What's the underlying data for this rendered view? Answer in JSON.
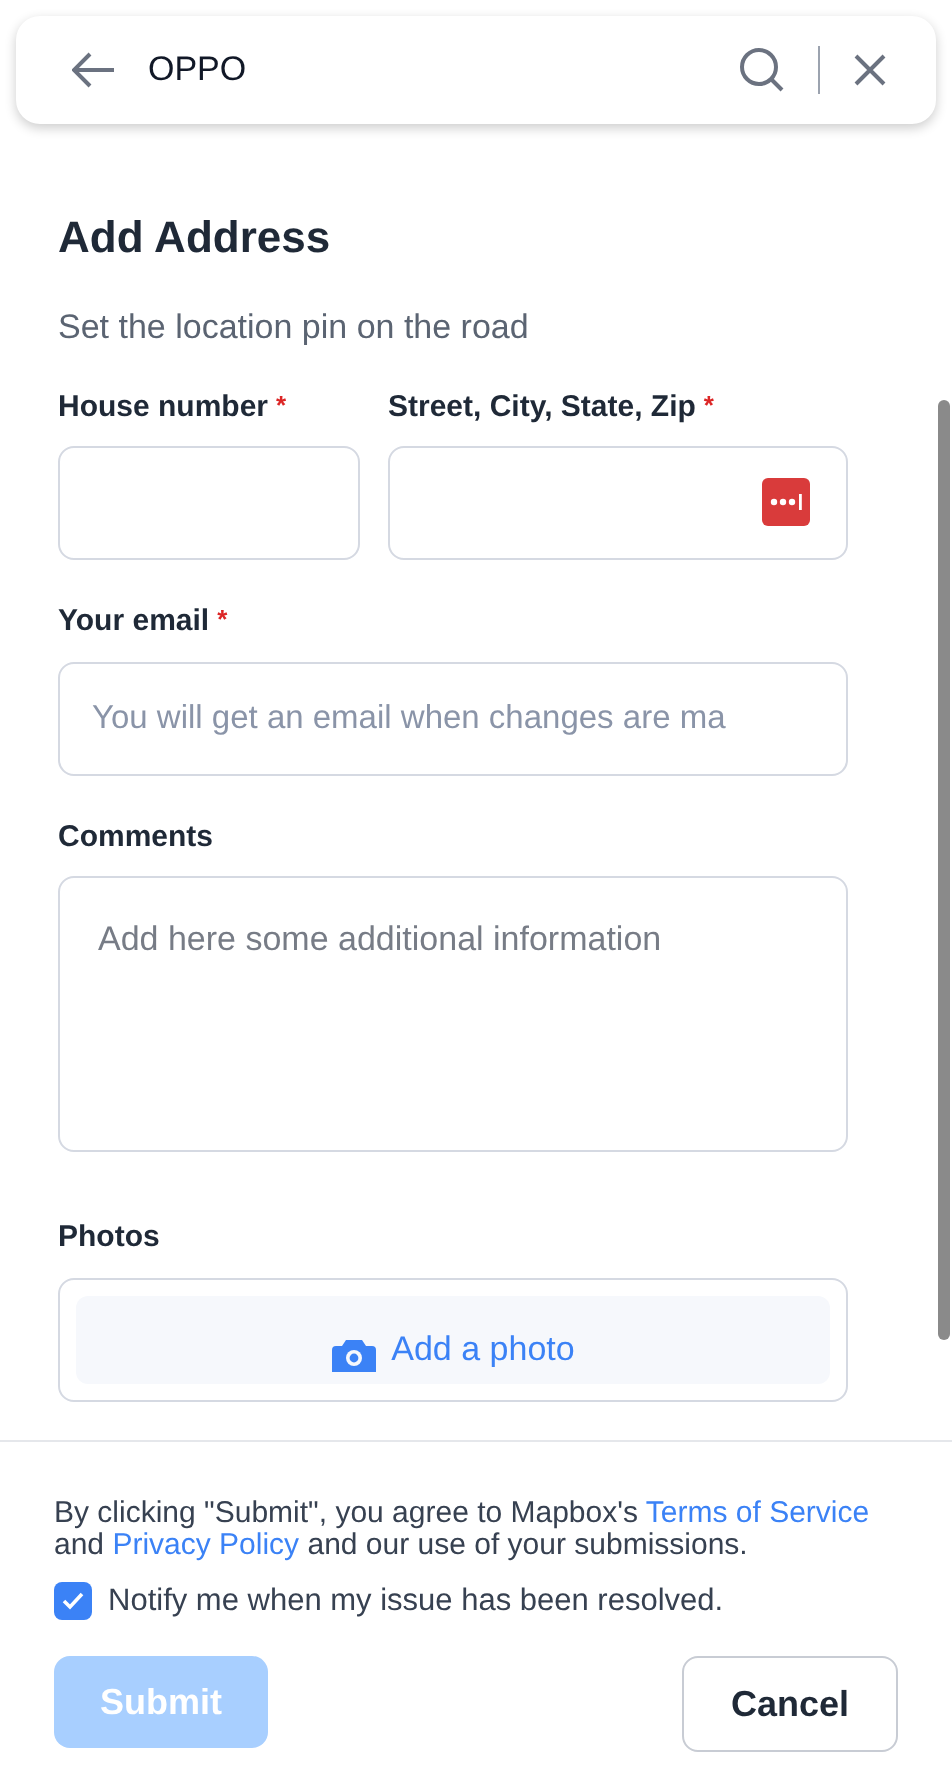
{
  "search_bar": {
    "value": "OPPO"
  },
  "title": "Add Address",
  "subtitle": "Set the location pin on the road",
  "fields": [
    {
      "kind": "input",
      "label": "House number",
      "required_mark": "*"
    },
    {
      "kind": "input",
      "label": "Street, City, State, Zip",
      "required_mark": "*",
      "menu_icon": true
    },
    {
      "kind": "input",
      "label": "Your email",
      "required_mark": "*",
      "placeholder": "You will get an email when changes are ma"
    },
    {
      "kind": "textarea",
      "label": "Comments",
      "placeholder": "Add here some additional information"
    }
  ],
  "photos": {
    "label": "Photos",
    "action": "Add a photo"
  },
  "footer": {
    "consent": [
      "By clicking \"Submit\", you agree to Mapbox's ",
      "Terms of Service",
      " and ",
      "Privacy Policy",
      " and our use of your submissions."
    ],
    "notify": {
      "label": "Notify me when my issue has been resolved.",
      "checked": true
    },
    "submit": {
      "label": "Submit",
      "disabled": true
    },
    "cancel": {
      "label": "Cancel"
    }
  }
}
